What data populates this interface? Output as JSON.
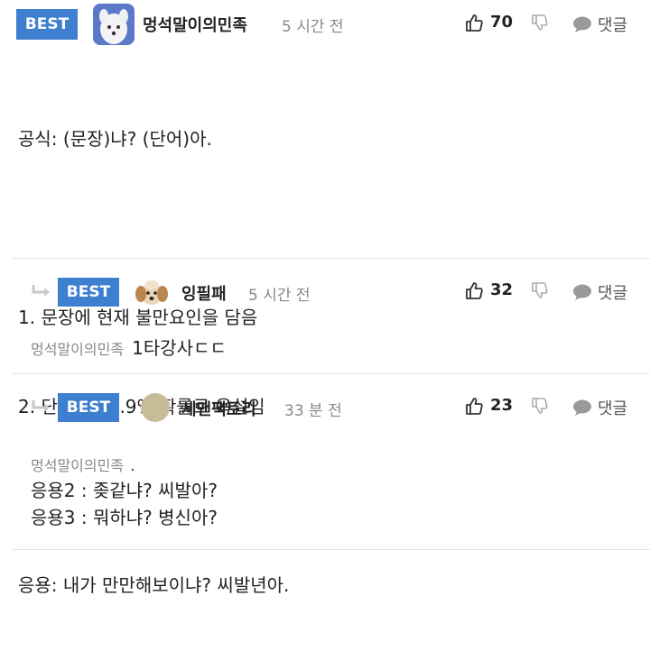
{
  "comments": [
    {
      "badge": "BEST",
      "nickname": "멍석말이의민족",
      "time": "5 시간 전",
      "likes": "70",
      "reply_label": "댓글",
      "avatar": "white-dog-avatar",
      "lines": [
        "공식: (문장)냐? (단어)아.",
        "",
        "1. 문장에 현재 불만요인을 담음",
        "2. 단어는 99.9% 확률로 욕설임",
        "",
        "응용: 내가 만만해보이냐? 씨발년아."
      ]
    },
    {
      "badge": "BEST",
      "nickname": "잉필패",
      "time": "5 시간 전",
      "likes": "32",
      "reply_label": "댓글",
      "avatar": "puppy-avatar",
      "mention": "멍석말이의민족",
      "text": "1타강사ㄷㄷ"
    },
    {
      "badge": "BEST",
      "nickname": "세맨팩토리",
      "time": "33 분 전",
      "likes": "23",
      "reply_label": "댓글",
      "avatar": "beige-circle-avatar",
      "mention": "멍석말이의민족",
      "mention_suffix": ".",
      "lines": [
        "응용2 : 좆같냐? 씨발아?",
        "응용3 : 뭐하냐? 병신아?"
      ]
    }
  ],
  "colors": {
    "badge": "#3f7fd0",
    "muted": "#888888",
    "icon": "#9a9a9a"
  },
  "icons": [
    "thumbs-up-icon",
    "thumbs-down-icon",
    "speech-bubble-icon",
    "reply-arrow-icon"
  ]
}
